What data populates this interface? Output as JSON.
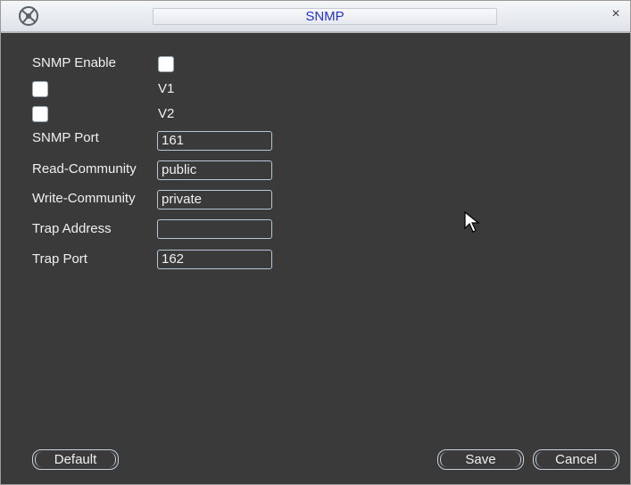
{
  "window": {
    "title": "SNMP",
    "close_glyph": "×"
  },
  "form": {
    "snmp_enable": {
      "label": "SNMP Enable",
      "checked": false
    },
    "v1": {
      "label": "V1",
      "checked": false
    },
    "v2": {
      "label": "V2",
      "checked": false
    },
    "snmp_port": {
      "label": "SNMP Port",
      "value": "161"
    },
    "read_community": {
      "label": "Read-Community",
      "value": "public"
    },
    "write_community": {
      "label": "Write-Community",
      "value": "private"
    },
    "trap_address": {
      "label": "Trap Address",
      "value": ""
    },
    "trap_port": {
      "label": "Trap Port",
      "value": "162"
    }
  },
  "buttons": {
    "default": "Default",
    "save": "Save",
    "cancel": "Cancel"
  },
  "colors": {
    "background": "#3a3a3a",
    "title_text": "#2233cc",
    "text": "#f0f0f0"
  }
}
